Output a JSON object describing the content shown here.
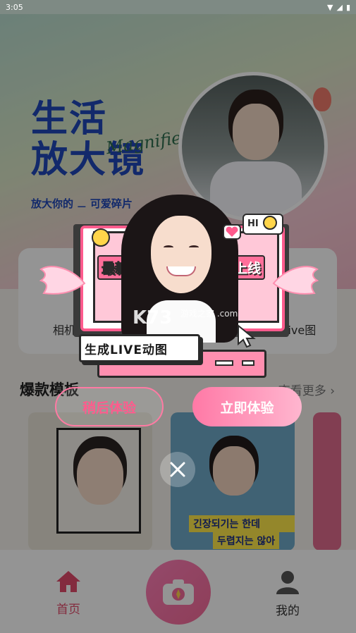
{
  "status_bar": {
    "time": "3:05"
  },
  "hero": {
    "title_line1": "生活",
    "title_line2": "放大镜",
    "script_text": "Magnifier",
    "subtitle": "放大你的 ⚊ 可爱碎片"
  },
  "categories": {
    "left_label": "相机",
    "right_label": "live图"
  },
  "section": {
    "title": "爆款模板",
    "more": "查看更多 ›"
  },
  "templates": {
    "card2_caption1": "긴장되기는 한데",
    "card2_caption2": "두렵지는 않아"
  },
  "bottom_nav": {
    "home_label": "首页",
    "mine_label": "我的"
  },
  "popup": {
    "tag_new": "最新",
    "tag_online": "上线",
    "bubble_hi": "HI",
    "main_label": "生成LIVE动图",
    "btn_later": "稍后体验",
    "btn_now": "立即体验",
    "watermark": "K73",
    "watermark_sub": "游戏之家 .com"
  },
  "colors": {
    "accent_pink": "#ff5b8d",
    "brand_blue": "#1f48b8",
    "home_active": "#e24b6b"
  }
}
